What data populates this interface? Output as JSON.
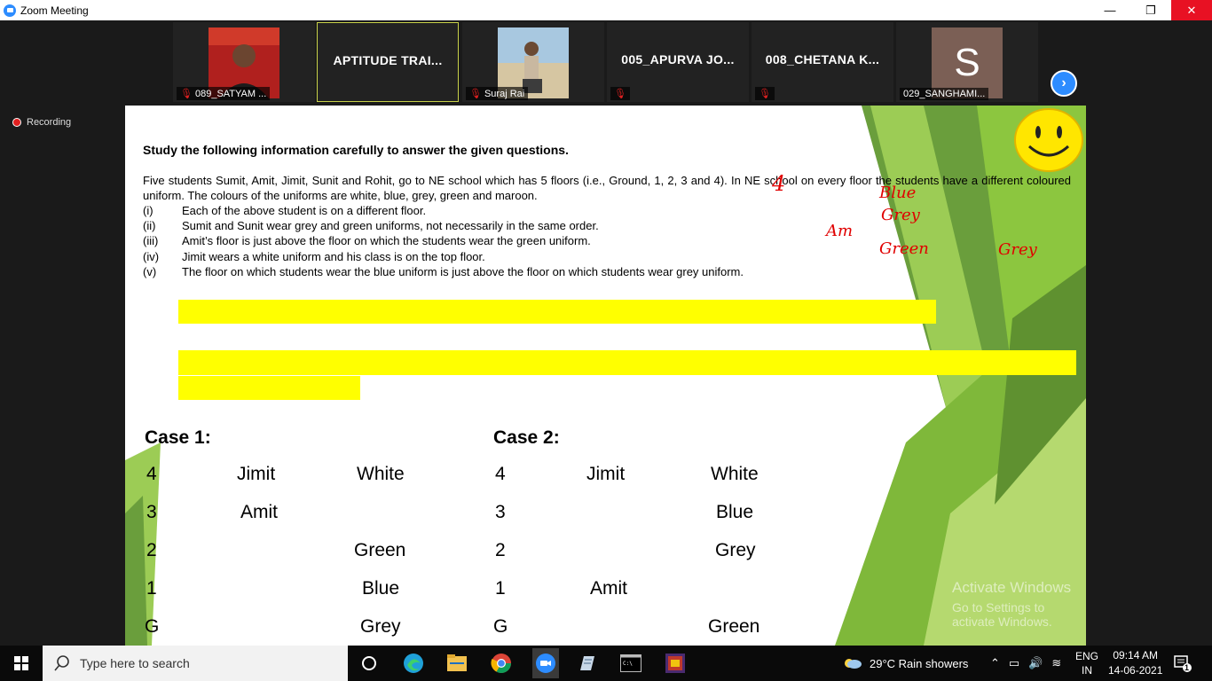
{
  "window": {
    "title": "Zoom Meeting",
    "minimize": "—",
    "maximize": "❐",
    "close": "✕"
  },
  "participants": [
    {
      "name": "089_SATYAM ..."
    },
    {
      "name": "APTITUDE TRAI..."
    },
    {
      "name": "Suraj Rai"
    },
    {
      "name": "005_APURVA JO..."
    },
    {
      "name": "008_CHETANA K..."
    },
    {
      "name": "029_SANGHAMI...",
      "initial": "S"
    }
  ],
  "recording": "Recording",
  "slide": {
    "heading": "Study the following information carefully to answer the given questions.",
    "paragraph": "Five students Sumit, Amit, Jimit, Sunit and Rohit, go to NE school which has 5 floors (i.e., Ground, 1, 2, 3 and 4). In NE school on every floor the students have a different coloured uniform. The colours of the uniforms are white, blue, grey, green and maroon.",
    "clues": [
      {
        "num": "(i)",
        "text": "Each of the above student is on a different floor."
      },
      {
        "num": "(ii)",
        "text": "Sumit and Sunit wear grey and green uniforms, not necessarily in the same order."
      },
      {
        "num": "(iii)",
        "text": "Amit’s floor is just above the floor on which the students wear the green uniform."
      },
      {
        "num": "(iv)",
        "text": "Jimit wears a white uniform and his class is on the top floor."
      },
      {
        "num": "(v)",
        "text": "The floor on which students wear the blue uniform is just above the floor on which students  wear grey uniform."
      }
    ],
    "annotations": {
      "four": "4",
      "blue": "Blue",
      "grey1": "Grey",
      "am": "Am",
      "green": "Green",
      "grey2": "Grey"
    },
    "case1": {
      "title": "Case 1:",
      "rows": [
        {
          "floor": "4",
          "name": "Jimit",
          "color": "White"
        },
        {
          "floor": "3",
          "name": "Amit",
          "color": ""
        },
        {
          "floor": "2",
          "name": "",
          "color": "Green"
        },
        {
          "floor": "1",
          "name": "",
          "color": "Blue"
        },
        {
          "floor": "G",
          "name": "",
          "color": "Grey"
        }
      ]
    },
    "case2": {
      "title": "Case 2:",
      "rows": [
        {
          "floor": "4",
          "name": "Jimit",
          "color": "White"
        },
        {
          "floor": "3",
          "name": "",
          "color": "Blue"
        },
        {
          "floor": "2",
          "name": "",
          "color": "Grey"
        },
        {
          "floor": "1",
          "name": "Amit",
          "color": ""
        },
        {
          "floor": "G",
          "name": "",
          "color": "Green"
        }
      ]
    },
    "watermark": {
      "line1": "Activate Windows",
      "line2": "Go to Settings to activate Windows."
    }
  },
  "taskbar": {
    "search_placeholder": "Type here to search",
    "weather": "29°C  Rain showers",
    "lang_top": "ENG",
    "lang_bottom": "IN",
    "time": "09:14 AM",
    "date": "14-06-2021",
    "notification_count": "1"
  },
  "colors": {
    "accent": "#2d8cff",
    "highlight": "#ffff00",
    "ink": "#e00000",
    "close": "#e81123"
  }
}
